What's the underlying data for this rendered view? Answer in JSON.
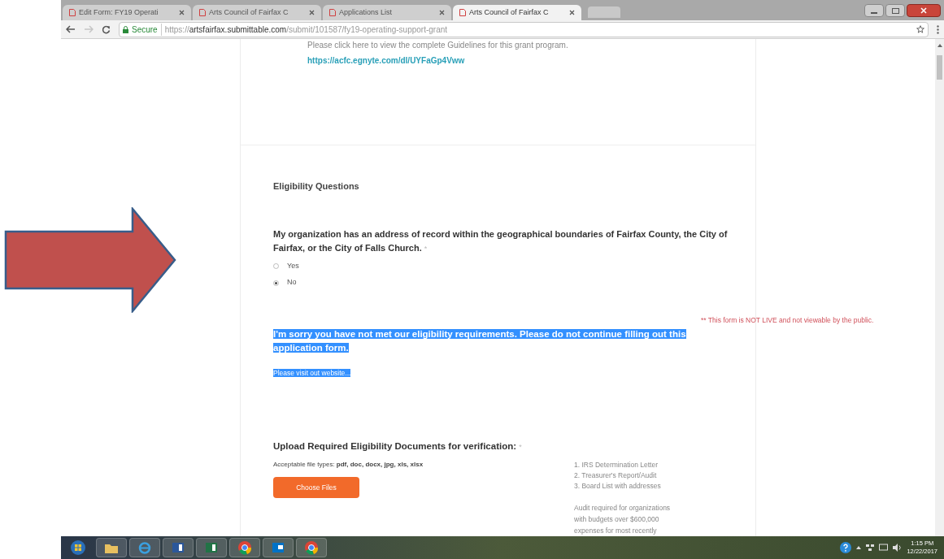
{
  "browser": {
    "tabs": [
      {
        "title": "Edit Form: FY19 Operati",
        "selected": false
      },
      {
        "title": "Arts Council of Fairfax C",
        "selected": false
      },
      {
        "title": "Applications List",
        "selected": false
      },
      {
        "title": "Arts Council of Fairfax C",
        "selected": true
      }
    ],
    "address": {
      "secure_label": "Secure",
      "url_scheme": "https://",
      "url_host": "artsfairfax.submittable.com",
      "url_path": "/submit/101587/fy19-operating-support-grant"
    }
  },
  "page": {
    "guidelines_text": "Please click here to view the complete Guidelines for this grant program.",
    "guidelines_link": "https://acfc.egnyte.com/dl/UYFaGp4Vww",
    "section_title": "Eligibility Questions",
    "question": {
      "text": "My organization has an address of record within the geographical boundaries of Fairfax County, the City of Fairfax, or the City of Falls Church.",
      "required_mark": "*"
    },
    "options": [
      {
        "label": "Yes",
        "selected": false
      },
      {
        "label": "No",
        "selected": true
      }
    ],
    "notice": "** This form is NOT LIVE and not viewable by the public.",
    "message": {
      "text": "I'm sorry you have not met our eligibility requirements. Please do not continue filling out this application form.",
      "highlighted": true
    },
    "message_link": {
      "text": "Please visit out website...",
      "highlighted": true
    },
    "upload": {
      "title": "Upload Required Eligibility Documents for verification:",
      "required_mark": "*",
      "file_types_label": "Acceptable file types:",
      "file_types": "pdf, doc, docx, jpg, xls, xlsx",
      "button": "Choose Files",
      "required_docs": [
        "1. IRS Determination Letter",
        "2. Treasurer's Report/Audit",
        "3. Board List with addresses"
      ],
      "note_lines": [
        "Audit required for organizations",
        "with budgets over $600,000",
        "expenses for most recently"
      ]
    }
  },
  "taskbar": {
    "apps": [
      {
        "kind": "start"
      },
      {
        "kind": "explorer"
      },
      {
        "kind": "ie"
      },
      {
        "kind": "word"
      },
      {
        "kind": "excel"
      },
      {
        "kind": "chrome"
      },
      {
        "kind": "outlook"
      },
      {
        "kind": "chrome"
      }
    ],
    "time": "1:15 PM",
    "date": "12/22/2017"
  }
}
